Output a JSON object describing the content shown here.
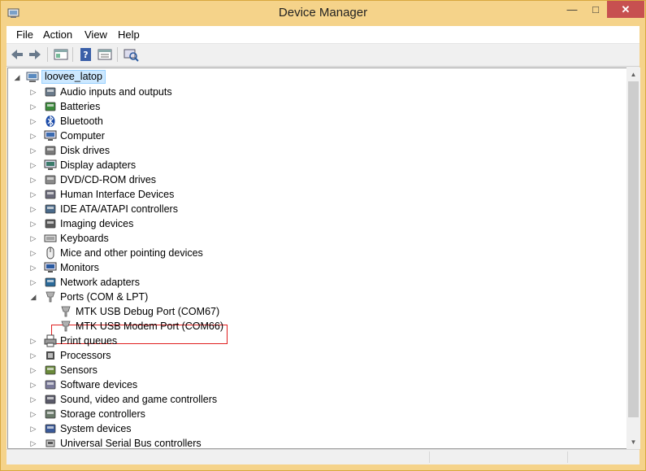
{
  "window": {
    "title": "Device Manager",
    "controls": {
      "minimize": "—",
      "maximize": "□",
      "close": "✕"
    },
    "border_color": "#d8a840",
    "titlebar_color": "#f5d38a"
  },
  "menu": {
    "file": "File",
    "action": "Action",
    "view": "View",
    "help": "Help"
  },
  "toolbar": {
    "buttons": [
      "back-icon",
      "forward-icon",
      "properties-pane-icon",
      "help-icon",
      "view-options-icon",
      "scan-hardware-icon"
    ]
  },
  "tree": {
    "root": "loovee_latop",
    "categories": [
      {
        "label": "Audio inputs and outputs",
        "icon": "audio-icon",
        "expanded": false
      },
      {
        "label": "Batteries",
        "icon": "battery-icon",
        "expanded": false
      },
      {
        "label": "Bluetooth",
        "icon": "bluetooth-icon",
        "expanded": false
      },
      {
        "label": "Computer",
        "icon": "computer-icon",
        "expanded": false
      },
      {
        "label": "Disk drives",
        "icon": "disk-drive-icon",
        "expanded": false
      },
      {
        "label": "Display adapters",
        "icon": "display-adapter-icon",
        "expanded": false
      },
      {
        "label": "DVD/CD-ROM drives",
        "icon": "dvd-drive-icon",
        "expanded": false
      },
      {
        "label": "Human Interface Devices",
        "icon": "hid-icon",
        "expanded": false
      },
      {
        "label": "IDE ATA/ATAPI controllers",
        "icon": "ide-controller-icon",
        "expanded": false
      },
      {
        "label": "Imaging devices",
        "icon": "camera-icon",
        "expanded": false
      },
      {
        "label": "Keyboards",
        "icon": "keyboard-icon",
        "expanded": false
      },
      {
        "label": "Mice and other pointing devices",
        "icon": "mouse-icon",
        "expanded": false
      },
      {
        "label": "Monitors",
        "icon": "monitor-icon",
        "expanded": false
      },
      {
        "label": "Network adapters",
        "icon": "network-icon",
        "expanded": false
      },
      {
        "label": "Ports (COM & LPT)",
        "icon": "port-icon",
        "expanded": true
      },
      {
        "label": "Print queues",
        "icon": "printer-icon",
        "expanded": false
      },
      {
        "label": "Processors",
        "icon": "processor-icon",
        "expanded": false
      },
      {
        "label": "Sensors",
        "icon": "sensor-icon",
        "expanded": false
      },
      {
        "label": "Software devices",
        "icon": "software-device-icon",
        "expanded": false
      },
      {
        "label": "Sound, video and game controllers",
        "icon": "speaker-icon",
        "expanded": false
      },
      {
        "label": "Storage controllers",
        "icon": "storage-controller-icon",
        "expanded": false
      },
      {
        "label": "System devices",
        "icon": "system-device-icon",
        "expanded": false
      },
      {
        "label": "Universal Serial Bus controllers",
        "icon": "usb-icon",
        "expanded": false
      }
    ],
    "port_children": [
      {
        "label": "MTK USB Debug Port (COM67)",
        "icon": "port-icon",
        "highlighted": true
      },
      {
        "label": "MTK USB Modem Port (COM66)",
        "icon": "port-icon",
        "highlighted": false
      }
    ],
    "highlight_color": "#e02020",
    "selection_color": "#cce8ff"
  }
}
